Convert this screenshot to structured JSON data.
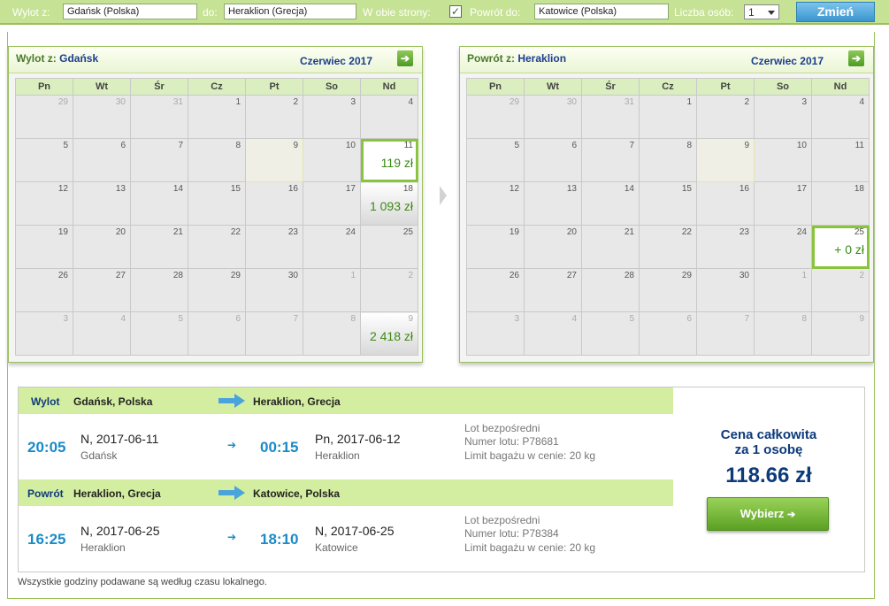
{
  "topbar": {
    "from_label": "Wylot z:",
    "from_value": "Gdańsk (Polska)",
    "to_label": "do:",
    "to_value": "Heraklion (Grecja)",
    "roundtrip_label": "W obie strony:",
    "roundtrip_checked": "✓",
    "return_label": "Powrót do:",
    "return_value": "Katowice (Polska)",
    "persons_label": "Liczba osób:",
    "persons_value": "1",
    "change_button": "Zmień"
  },
  "calendars": {
    "weekdays": [
      "Pn",
      "Wt",
      "Śr",
      "Cz",
      "Pt",
      "So",
      "Nd"
    ],
    "outbound": {
      "title_prefix": "Wylot z:",
      "title_city": "Gdańsk",
      "month": "Czerwiec 2017",
      "weeks": [
        [
          {
            "d": "29",
            "o": 1
          },
          {
            "d": "30",
            "o": 1
          },
          {
            "d": "31",
            "o": 1
          },
          {
            "d": "1"
          },
          {
            "d": "2"
          },
          {
            "d": "3"
          },
          {
            "d": "4"
          }
        ],
        [
          {
            "d": "5"
          },
          {
            "d": "6"
          },
          {
            "d": "7"
          },
          {
            "d": "8"
          },
          {
            "d": "9",
            "hl": 1
          },
          {
            "d": "10"
          },
          {
            "d": "11",
            "p": "119 zł",
            "s": 1
          }
        ],
        [
          {
            "d": "12"
          },
          {
            "d": "13"
          },
          {
            "d": "14"
          },
          {
            "d": "15"
          },
          {
            "d": "16"
          },
          {
            "d": "17"
          },
          {
            "d": "18",
            "p": "1 093 zł"
          }
        ],
        [
          {
            "d": "19"
          },
          {
            "d": "20"
          },
          {
            "d": "21"
          },
          {
            "d": "22"
          },
          {
            "d": "23"
          },
          {
            "d": "24"
          },
          {
            "d": "25"
          }
        ],
        [
          {
            "d": "26"
          },
          {
            "d": "27"
          },
          {
            "d": "28"
          },
          {
            "d": "29"
          },
          {
            "d": "30"
          },
          {
            "d": "1",
            "o": 1
          },
          {
            "d": "2",
            "o": 1
          }
        ],
        [
          {
            "d": "3",
            "o": 1
          },
          {
            "d": "4",
            "o": 1
          },
          {
            "d": "5",
            "o": 1
          },
          {
            "d": "6",
            "o": 1
          },
          {
            "d": "7",
            "o": 1
          },
          {
            "d": "8",
            "o": 1
          },
          {
            "d": "9",
            "o": 1,
            "p": "2 418 zł"
          }
        ]
      ]
    },
    "return": {
      "title_prefix": "Powrót z:",
      "title_city": "Heraklion",
      "month": "Czerwiec 2017",
      "weeks": [
        [
          {
            "d": "29",
            "o": 1
          },
          {
            "d": "30",
            "o": 1
          },
          {
            "d": "31",
            "o": 1
          },
          {
            "d": "1"
          },
          {
            "d": "2"
          },
          {
            "d": "3"
          },
          {
            "d": "4"
          }
        ],
        [
          {
            "d": "5"
          },
          {
            "d": "6"
          },
          {
            "d": "7"
          },
          {
            "d": "8"
          },
          {
            "d": "9",
            "hl": 1
          },
          {
            "d": "10"
          },
          {
            "d": "11"
          }
        ],
        [
          {
            "d": "12"
          },
          {
            "d": "13"
          },
          {
            "d": "14"
          },
          {
            "d": "15"
          },
          {
            "d": "16"
          },
          {
            "d": "17"
          },
          {
            "d": "18"
          }
        ],
        [
          {
            "d": "19"
          },
          {
            "d": "20"
          },
          {
            "d": "21"
          },
          {
            "d": "22"
          },
          {
            "d": "23"
          },
          {
            "d": "24"
          },
          {
            "d": "25",
            "p": "+ 0 zł",
            "s": 1
          }
        ],
        [
          {
            "d": "26"
          },
          {
            "d": "27"
          },
          {
            "d": "28"
          },
          {
            "d": "29"
          },
          {
            "d": "30"
          },
          {
            "d": "1",
            "o": 1
          },
          {
            "d": "2",
            "o": 1
          }
        ],
        [
          {
            "d": "3",
            "o": 1
          },
          {
            "d": "4",
            "o": 1
          },
          {
            "d": "5",
            "o": 1
          },
          {
            "d": "6",
            "o": 1
          },
          {
            "d": "7",
            "o": 1
          },
          {
            "d": "8",
            "o": 1
          },
          {
            "d": "9",
            "o": 1
          }
        ]
      ]
    }
  },
  "outbound": {
    "kind": "Wylot",
    "from": "Gdańsk, Polska",
    "to": "Heraklion, Grecja",
    "dep_time": "20:05",
    "dep_date": "N, 2017-06-11",
    "dep_city": "Gdańsk",
    "arr_time": "00:15",
    "arr_date": "Pn, 2017-06-12",
    "arr_city": "Heraklion",
    "direct": "Lot bezpośredni",
    "flight_no": "Numer lotu: P78681",
    "baggage": "Limit bagażu w cenie: 20 kg"
  },
  "return": {
    "kind": "Powrót",
    "from": "Heraklion, Grecja",
    "to": "Katowice, Polska",
    "dep_time": "16:25",
    "dep_date": "N, 2017-06-25",
    "dep_city": "Heraklion",
    "arr_time": "18:10",
    "arr_date": "N, 2017-06-25",
    "arr_city": "Katowice",
    "direct": "Lot bezpośredni",
    "flight_no": "Numer lotu: P78384",
    "baggage": "Limit bagażu w cenie: 20 kg"
  },
  "price": {
    "label_line1": "Cena całkowita",
    "label_line2": "za 1 osobę",
    "amount": "118.66 zł",
    "select_button": "Wybierz"
  },
  "footnote": "Wszystkie godziny podawane są według czasu lokalnego.",
  "colors": {
    "accent_green": "#9ac05b",
    "price_green": "#3c8a14",
    "time_blue": "#1a8ac9",
    "title_navy": "#0d3a7a"
  }
}
